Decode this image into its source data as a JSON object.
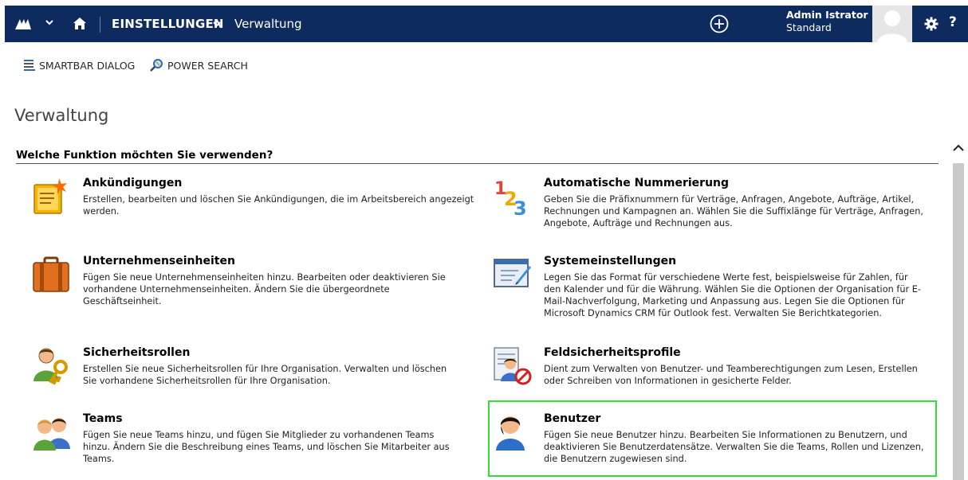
{
  "topnav": {
    "section_label": "EINSTELLUNGEN",
    "breadcrumb": "Verwaltung",
    "user_name": "Admin Istrator",
    "user_org": "Standard",
    "help_label": "?"
  },
  "smartbar": {
    "items": [
      {
        "label": "SMARTBAR DIALOG"
      },
      {
        "label": "POWER SEARCH"
      }
    ]
  },
  "main": {
    "page_title": "Verwaltung",
    "section_heading": "Welche Funktion möchten Sie verwenden?",
    "tiles": [
      {
        "title": "Ankündigungen",
        "icon": "announcement-icon",
        "description": "Erstellen, bearbeiten und löschen Sie Ankündigungen, die im Arbeitsbereich angezeigt werden."
      },
      {
        "title": "Automatische Nummerierung",
        "icon": "numbering-icon",
        "description": "Geben Sie die Präfixnummern für Verträge, Anfragen, Angebote, Aufträge, Artikel, Rechnungen und Kampagnen an. Wählen Sie die Suffixlänge für Verträge, Anfragen, Angebote, Aufträge und Rechnungen aus."
      },
      {
        "title": "Unternehmenseinheiten",
        "icon": "briefcase-icon",
        "description": "Fügen Sie neue Unternehmenseinheiten hinzu. Bearbeiten oder deaktivieren Sie vorhandene Unternehmenseinheiten. Ändern Sie die übergeordnete Geschäftseinheit."
      },
      {
        "title": "Systemeinstellungen",
        "icon": "system-settings-icon",
        "description": "Legen Sie das Format für verschiedene Werte fest, beispielsweise für Zahlen, für den Kalender und für die Währung. Wählen Sie die Optionen der Organisation für E-Mail-Nachverfolgung, Marketing und Anpassung aus. Legen Sie die Optionen für Microsoft Dynamics CRM für Outlook fest. Verwalten Sie Berichtkategorien."
      },
      {
        "title": "Sicherheitsrollen",
        "icon": "security-roles-icon",
        "description": "Erstellen Sie neue Sicherheitsrollen für Ihre Organisation. Verwalten und löschen Sie vorhandene Sicherheitsrollen für Ihre Organisation."
      },
      {
        "title": "Feldsicherheitsprofile",
        "icon": "field-security-icon",
        "description": "Dient zum Verwalten von Benutzer- und Teamberechtigungen zum Lesen, Erstellen oder Schreiben von Informationen in gesicherte Felder."
      },
      {
        "title": "Teams",
        "icon": "teams-icon",
        "description": "Fügen Sie neue Teams hinzu, und fügen Sie Mitglieder zu vorhandenen Teams hinzu. Ändern Sie die Beschreibung eines Teams, und löschen Sie Mitarbeiter aus Teams."
      },
      {
        "title": "Benutzer",
        "icon": "user-icon",
        "description": "Fügen Sie neue Benutzer hinzu. Bearbeiten Sie Informationen zu Benutzern, und deaktivieren Sie Benutzerdatensätze. Verwalten Sie die Teams, Rollen und Lizenzen, die Benutzern zugewiesen sind."
      }
    ]
  },
  "colors": {
    "nav_bg": "#0e2b5f",
    "highlight_border": "#33dd33"
  }
}
